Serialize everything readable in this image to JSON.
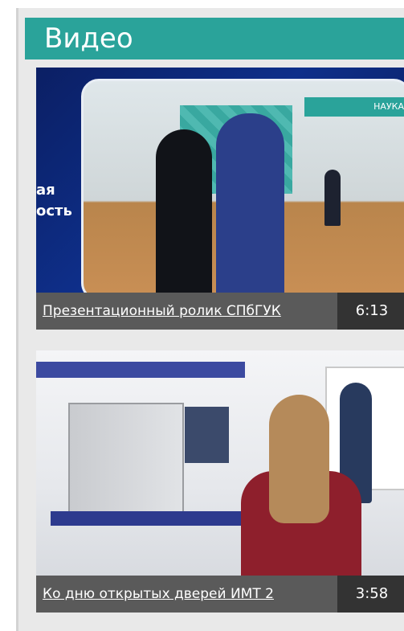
{
  "section": {
    "title": "Видео"
  },
  "videos": [
    {
      "title": "Презентационный ролик СПбГУК",
      "duration": "6:13",
      "thumb_tag": "НАУКА",
      "thumb_side_text": "ая\nость"
    },
    {
      "title": "Ко дню открытых дверей ИМТ 2",
      "duration": "3:58"
    }
  ],
  "colors": {
    "header": "#2aa39a",
    "caption_bg": "#5a5a5a",
    "duration_bg": "#333333",
    "panel_bg": "#e9e9e9"
  }
}
